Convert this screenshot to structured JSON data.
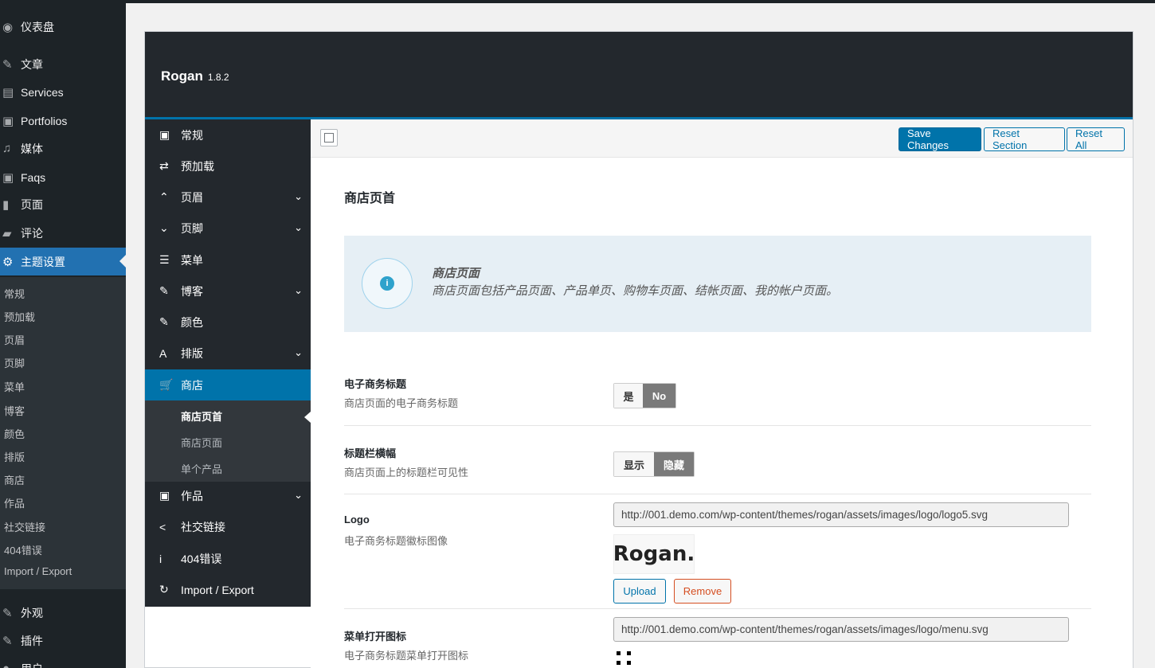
{
  "wp_menu": {
    "items": [
      {
        "icon": "dashboard-icon",
        "glyph": "◉",
        "label": "仪表盘"
      },
      {
        "icon": "pin-icon",
        "glyph": "✎",
        "label": "文章"
      },
      {
        "icon": "services-icon",
        "glyph": "▤",
        "label": "Services"
      },
      {
        "icon": "portfolio-icon",
        "glyph": "▣",
        "label": "Portfolios"
      },
      {
        "icon": "media-icon",
        "glyph": "♫",
        "label": "媒体"
      },
      {
        "icon": "faq-icon",
        "glyph": "▣",
        "label": "Faqs"
      },
      {
        "icon": "page-icon",
        "glyph": "▮",
        "label": "页面"
      },
      {
        "icon": "comment-icon",
        "glyph": "▰",
        "label": "评论"
      },
      {
        "icon": "gear-icon",
        "glyph": "⚙",
        "label": "主题设置"
      }
    ],
    "sub_items": [
      "常规",
      "预加载",
      "页眉",
      "页脚",
      "菜单",
      "博客",
      "颜色",
      "排版",
      "商店",
      "作品",
      "社交链接",
      "404错误",
      "Import / Export"
    ],
    "bottom_items": [
      {
        "icon": "appearance-icon",
        "glyph": "✎",
        "label": "外观"
      },
      {
        "icon": "plugin-icon",
        "glyph": "✎",
        "label": "插件"
      },
      {
        "icon": "user-icon",
        "glyph": "●",
        "label": "用户"
      }
    ]
  },
  "header": {
    "title": "Rogan",
    "version": "1.8.2"
  },
  "redux_menu": {
    "items": [
      {
        "icon": "general-icon",
        "glyph": "▣",
        "label": "常规",
        "chevron": ""
      },
      {
        "icon": "preload-icon",
        "glyph": "⇄",
        "label": "预加载",
        "chevron": ""
      },
      {
        "icon": "chevron-up-icon",
        "glyph": "⌃",
        "label": "页眉",
        "chevron": "⌄"
      },
      {
        "icon": "chevron-down-icon",
        "glyph": "⌄",
        "label": "页脚",
        "chevron": "⌄"
      },
      {
        "icon": "menu-icon",
        "glyph": "☰",
        "label": "菜单",
        "chevron": ""
      },
      {
        "icon": "pin-icon",
        "glyph": "✎",
        "label": "博客",
        "chevron": "⌄"
      },
      {
        "icon": "brush-icon",
        "glyph": "✎",
        "label": "颜色",
        "chevron": ""
      },
      {
        "icon": "typography-icon",
        "glyph": "A",
        "label": "排版",
        "chevron": "⌄"
      },
      {
        "icon": "cart-icon",
        "glyph": "🛒",
        "label": "商店",
        "chevron": ""
      }
    ],
    "shop_sub": [
      "商店页首",
      "商店页面",
      "单个产品"
    ],
    "after_items": [
      {
        "icon": "portfolio-icon",
        "glyph": "▣",
        "label": "作品",
        "chevron": "⌄"
      },
      {
        "icon": "share-icon",
        "glyph": "<",
        "label": "社交链接",
        "chevron": ""
      },
      {
        "icon": "info-icon",
        "glyph": "i",
        "label": "404错误",
        "chevron": ""
      },
      {
        "icon": "refresh-icon",
        "glyph": "↻",
        "label": "Import / Export",
        "chevron": ""
      }
    ]
  },
  "toolbar": {
    "save_label": "Save Changes",
    "reset_section_label": "Reset Section",
    "reset_all_label": "Reset All"
  },
  "main": {
    "section_title": "商店页首",
    "info": {
      "title": "商店页面",
      "desc": "商店页面包括产品页面、产品单页、购物车页面、结帐页面、我的帐户页面。",
      "glyph": "i"
    },
    "fields": {
      "ecommerce_title": {
        "label": "电子商务标题",
        "desc": "商店页面的电子商务标题",
        "off": "是",
        "on": "No"
      },
      "title_bar": {
        "label": "标题栏横幅",
        "desc": "商店页面上的标题栏可见性",
        "off": "显示",
        "on": "隐藏"
      },
      "logo": {
        "label": "Logo",
        "desc": "电子商务标题徽标图像",
        "url": "http://001.demo.com/wp-content/themes/rogan/assets/images/logo/logo5.svg",
        "preview_text": "Rogan.",
        "upload_label": "Upload",
        "remove_label": "Remove"
      },
      "menu_icon": {
        "label": "菜单打开图标",
        "desc": "电子商务标题菜单打开图标",
        "url": "http://001.demo.com/wp-content/themes/rogan/assets/images/logo/menu.svg"
      }
    }
  }
}
